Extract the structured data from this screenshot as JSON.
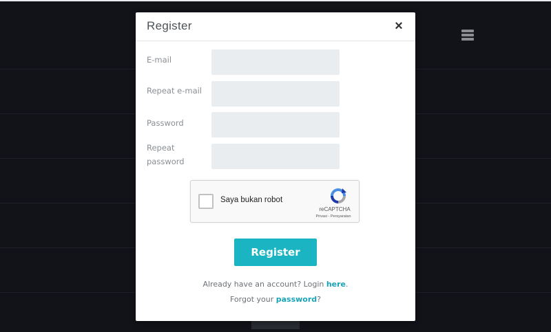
{
  "modal": {
    "title": "Register",
    "close_symbol": "×"
  },
  "form": {
    "fields": [
      {
        "label": "E-mail",
        "value": ""
      },
      {
        "label": "Repeat e-mail",
        "value": ""
      },
      {
        "label": "Password",
        "value": ""
      },
      {
        "label": "Repeat password",
        "value": ""
      }
    ]
  },
  "captcha": {
    "label": "Saya bukan robot",
    "brand": "reCAPTCHA",
    "links": "Privasi - Persyaratan"
  },
  "actions": {
    "register_label": "Register"
  },
  "footer": {
    "login_prefix": "Already have an account? Login ",
    "login_link": "here",
    "login_suffix": ".",
    "forgot_prefix": "Forgot your ",
    "forgot_link": "password",
    "forgot_suffix": "?"
  },
  "colors": {
    "accent": "#1ab4c3",
    "link": "#1aa3b5",
    "overlay_background": "#121319"
  },
  "icons": {
    "close": "close-icon",
    "menu": "hamburger-menu-icon",
    "recaptcha": "recaptcha-logo-icon"
  }
}
